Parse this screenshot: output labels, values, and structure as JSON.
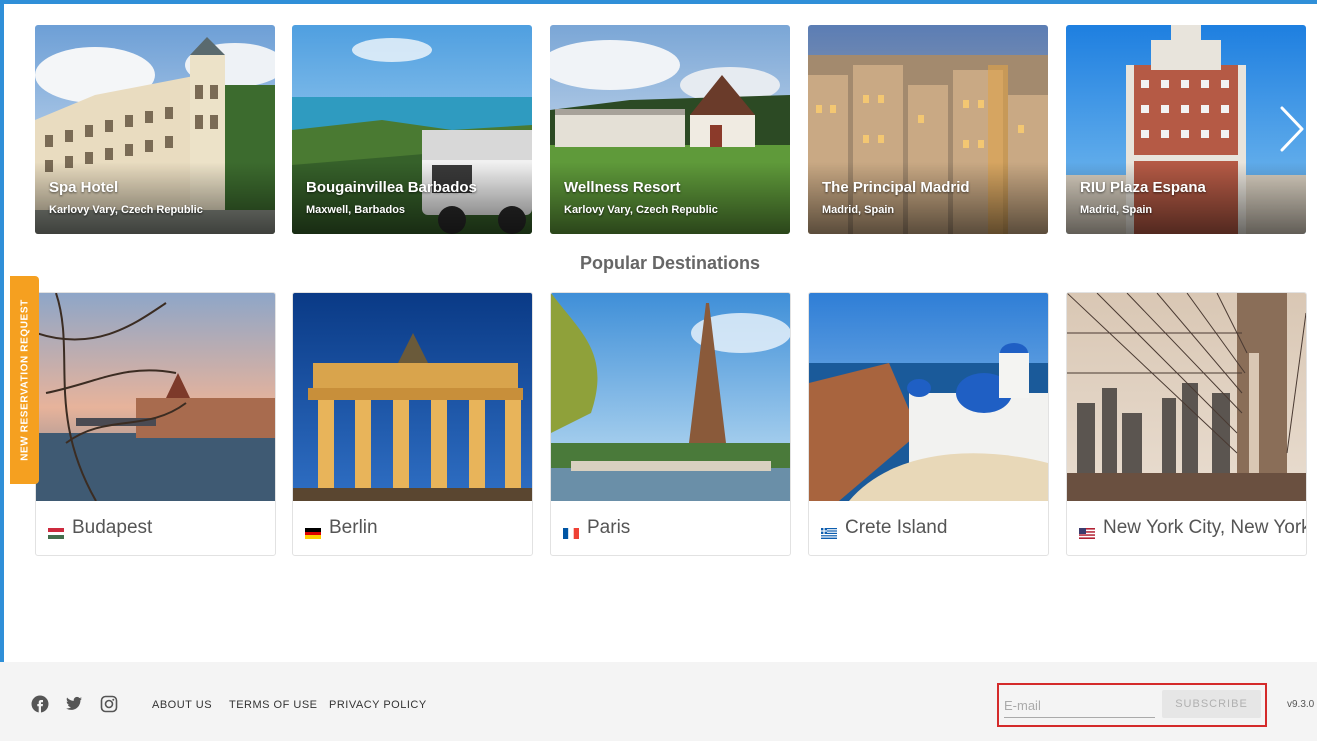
{
  "hotels": [
    {
      "name": "Spa Hotel",
      "location": "Karlovy Vary, Czech Republic"
    },
    {
      "name": "Bougainvillea Barbados",
      "location": "Maxwell, Barbados"
    },
    {
      "name": "Wellness Resort",
      "location": "Karlovy Vary, Czech Republic"
    },
    {
      "name": "The Principal Madrid",
      "location": "Madrid, Spain"
    },
    {
      "name": "RIU Plaza Espana",
      "location": "Madrid, Spain"
    }
  ],
  "carousel": {
    "next_icon": "chevron-right-icon"
  },
  "popular": {
    "title": "Popular Destinations",
    "destinations": [
      {
        "name": "Budapest",
        "flag": "hungary-flag-icon"
      },
      {
        "name": "Berlin",
        "flag": "germany-flag-icon"
      },
      {
        "name": "Paris",
        "flag": "france-flag-icon"
      },
      {
        "name": "Crete Island",
        "flag": "greece-flag-icon"
      },
      {
        "name": "New York City, New York",
        "flag": "usa-flag-icon"
      }
    ]
  },
  "side_tab": {
    "label": "NEW RESERVATION REQUEST",
    "color": "#f5a020"
  },
  "footer": {
    "social": [
      "facebook-icon",
      "twitter-icon",
      "instagram-icon"
    ],
    "links": [
      "ABOUT US",
      "TERMS OF USE",
      "PRIVACY POLICY"
    ],
    "email_placeholder": "E-mail",
    "subscribe_label": "SUBSCRIBE",
    "version": "v9.3.0"
  },
  "colors": {
    "accent_frame": "#2f8fd8",
    "highlight_border": "#d42a2a"
  }
}
